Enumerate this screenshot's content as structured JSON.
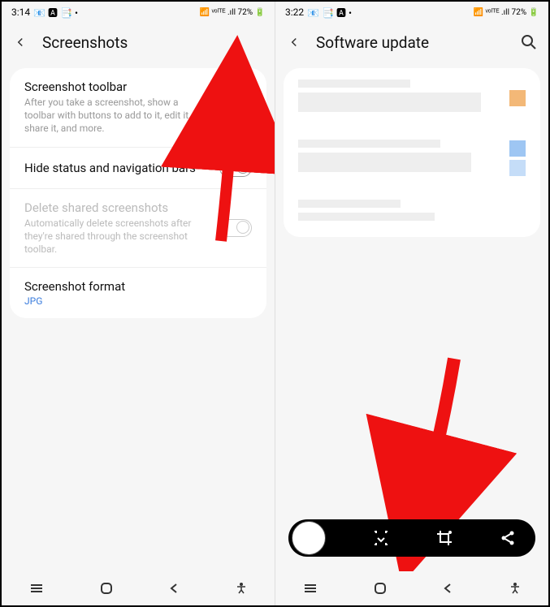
{
  "left": {
    "status": {
      "time": "3:14",
      "indicators": "📧 🅰 📑 •",
      "right": "📶 ᵛᵒˡᵀᴱ .ıll 72% 🔋"
    },
    "header": {
      "title": "Screenshots"
    },
    "rows": [
      {
        "title": "Screenshot toolbar",
        "desc": "After you take a screenshot, show a toolbar with buttons to add to it, edit it, share it, and more.",
        "toggle": true
      },
      {
        "title": "Hide status and navigation bars",
        "toggle": true
      },
      {
        "title": "Delete shared screenshots",
        "desc": "Automatically delete screenshots after they're shared through the screenshot toolbar.",
        "toggle": true,
        "disabled": true
      },
      {
        "title": "Screenshot format",
        "sub": "JPG"
      }
    ]
  },
  "right": {
    "status": {
      "time": "3:22",
      "indicators": "📧 📑 🅰 •",
      "right": "📶 ᵛᵒˡᵀᴱ .ıll 72% 🔋"
    },
    "header": {
      "title": "Software update"
    }
  }
}
